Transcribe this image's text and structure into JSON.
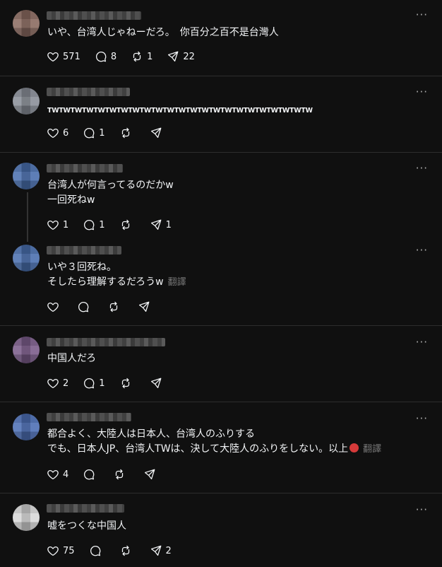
{
  "posts": [
    {
      "avatar_color": "#8a6a60",
      "lines": [
        "いや、台湾人じゃねーだろ。　你百分之百不是台灣人"
      ],
      "translate": "",
      "likes": "571",
      "comments": "8",
      "reposts": "1",
      "shares": "22"
    },
    {
      "avatar_color": "#8a8f98",
      "lines": [
        "TWTWTWTWTWTWTWTWTWTWTWTWTWTWTWTWTWTWTWTWTWTWTW"
      ],
      "translate": "",
      "likes": "6",
      "comments": "1",
      "reposts": "",
      "shares": ""
    },
    {
      "avatar_color": "#4a6fae",
      "lines": [
        "台湾人が何言ってるのだかw",
        "一回死ねw"
      ],
      "translate": "",
      "likes": "1",
      "comments": "1",
      "reposts": "",
      "shares": "1"
    },
    {
      "avatar_color": "#4a6fae",
      "lines": [
        "いや３回死ね。",
        "そしたら理解するだろうw"
      ],
      "translate": "翻譯",
      "likes": "",
      "comments": "",
      "reposts": "",
      "shares": ""
    },
    {
      "avatar_color": "#7b5c8a",
      "lines": [
        "中国人だろ"
      ],
      "translate": "",
      "likes": "2",
      "comments": "1",
      "reposts": "",
      "shares": ""
    },
    {
      "avatar_color": "#4d6fb5",
      "lines": [
        "都合よく、大陸人は日本人、台湾人のふりする",
        "でも、日本人JP、台湾人TWは、決して大陸人のふりをしない。以上"
      ],
      "translate": "翻譯",
      "likes": "4",
      "comments": "",
      "reposts": "",
      "shares": ""
    },
    {
      "avatar_color": "#d8d8d8",
      "lines": [
        "嘘をつくな中国人"
      ],
      "translate": "",
      "likes": "75",
      "comments": "",
      "reposts": "",
      "shares": "2"
    }
  ],
  "icons": {
    "like": "heart-icon",
    "comment": "comment-icon",
    "repost": "repost-icon",
    "share": "share-icon",
    "more": "more-icon"
  },
  "colors": {
    "background": "#101010",
    "text": "#f3f5f7",
    "divider": "#2d2d2d",
    "muted": "#777777"
  }
}
